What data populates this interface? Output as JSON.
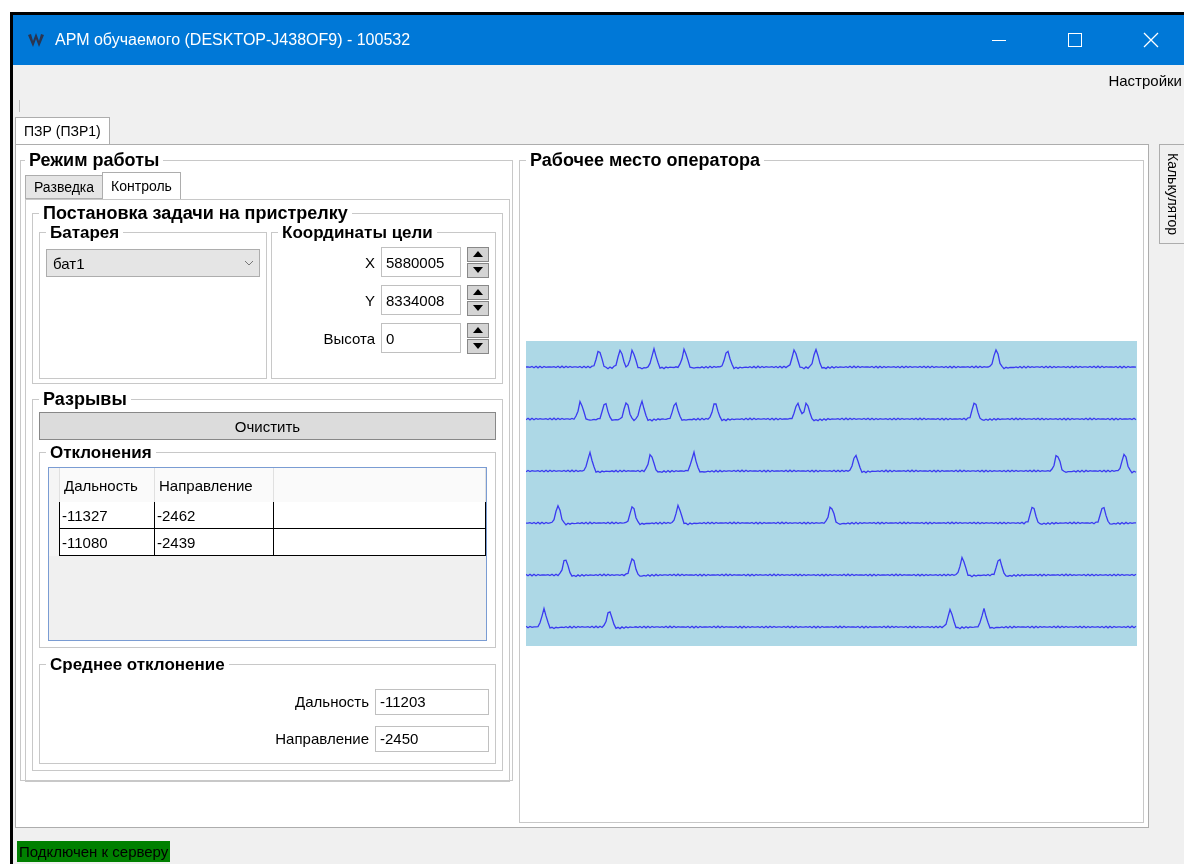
{
  "window": {
    "title": "АРМ обучаемого (DESKTOP-J438OF9) - 100532"
  },
  "menu": [
    {
      "label": "Настройки"
    }
  ],
  "tabs": [
    {
      "label": "ПЗР (ПЗР1)",
      "selected": true
    }
  ],
  "side_tabs": [
    {
      "label": "Калькулятор",
      "selected": false
    }
  ],
  "mode_panel": {
    "title": "Режим работы",
    "tabs": [
      {
        "label": "Разведка",
        "selected": false
      },
      {
        "label": "Контроль",
        "selected": true
      }
    ],
    "task": {
      "title": "Постановка задачи на пристрелку",
      "battery": {
        "title": "Батарея",
        "value": "бат1"
      },
      "coords": {
        "title": "Координаты цели",
        "fields": [
          {
            "label": "X",
            "value": "5880005"
          },
          {
            "label": "Y",
            "value": "8334008"
          },
          {
            "label": "Высота",
            "value": "0"
          }
        ]
      }
    },
    "bursts": {
      "title": "Разрывы",
      "clear_button": "Очистить",
      "deviations": {
        "title": "Отклонения",
        "columns": [
          "Дальность",
          "Направление"
        ],
        "rows": [
          [
            "-11327",
            "-2462"
          ],
          [
            "-11080",
            "-2439"
          ]
        ]
      },
      "average": {
        "title": "Среднее отклонение",
        "fields": [
          {
            "label": "Дальность",
            "value": "-11203"
          },
          {
            "label": "Направление",
            "value": "-2450"
          }
        ]
      }
    }
  },
  "operator_panel": {
    "title": "Рабочее место оператора"
  },
  "status_bar": {
    "text": "Подключен к серверу"
  }
}
